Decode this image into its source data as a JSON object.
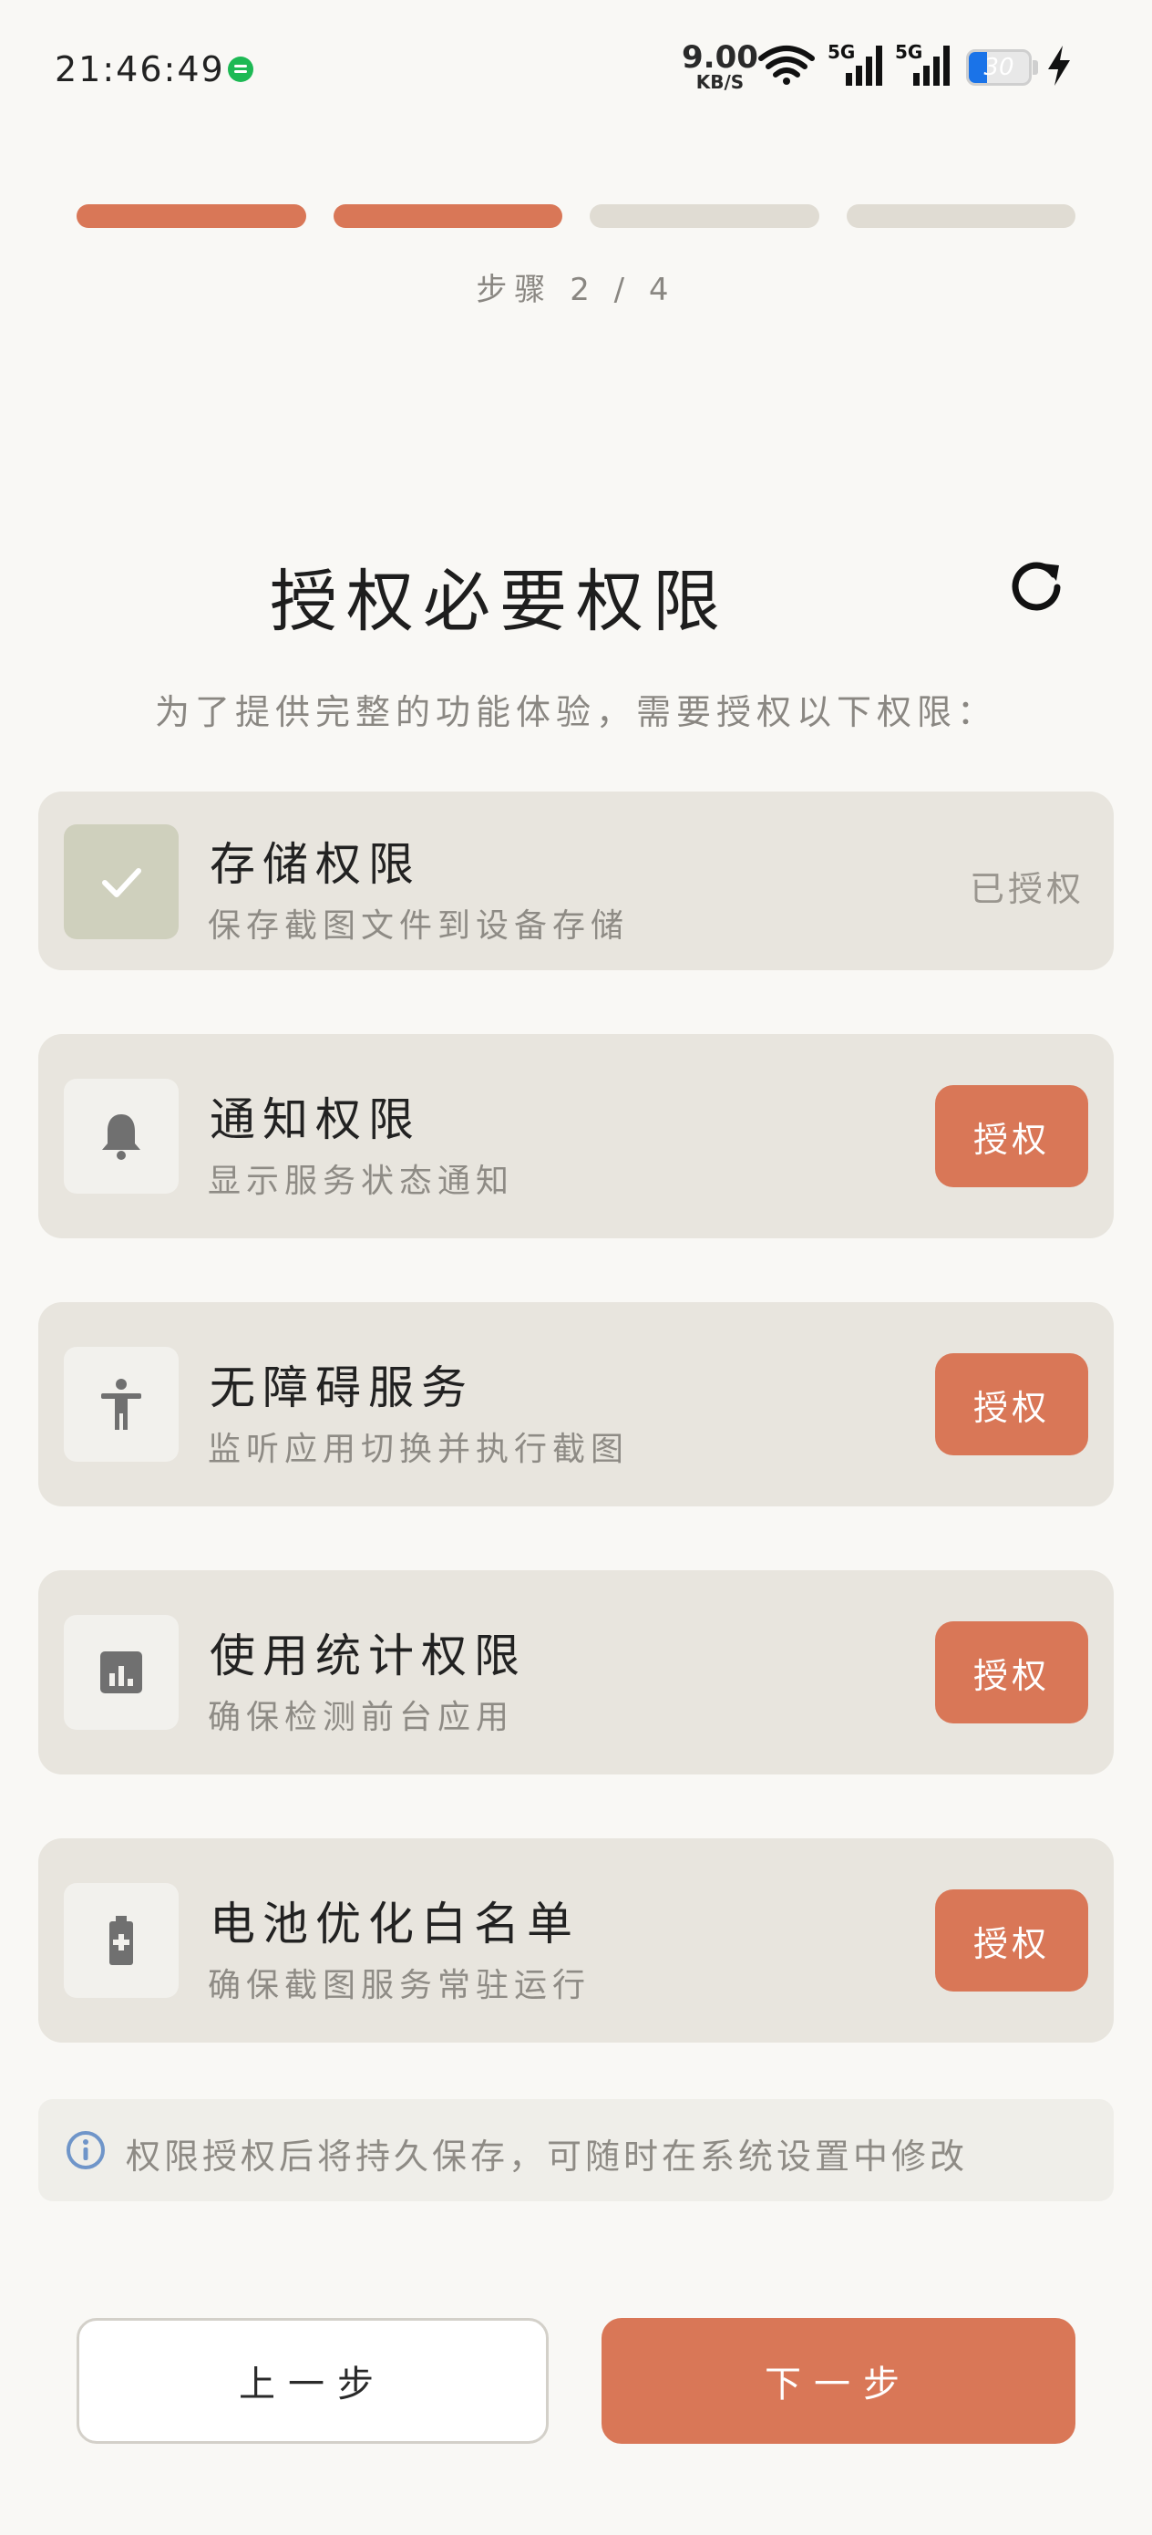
{
  "status_bar": {
    "time": "21:46:49",
    "net_speed_value": "9.00",
    "net_speed_unit": "KB/S",
    "signal1_label": "5G",
    "signal2_label": "5G",
    "battery_level": "30",
    "battery_fraction": 0.3,
    "battery_color": "#1a73e8"
  },
  "progress": {
    "total_steps": 4,
    "current_step": 2,
    "step_text": "步骤 2 / 4",
    "active_color": "#d97757",
    "inactive_color": "#e0dcd3"
  },
  "header": {
    "title": "授权必要权限",
    "refresh_icon": "refresh-icon",
    "subtitle": "为了提供完整的功能体验，需要授权以下权限："
  },
  "permissions": [
    {
      "icon": "check-icon",
      "name": "存储权限",
      "desc": "保存截图文件到设备存储",
      "granted": true,
      "status_text": "已授权"
    },
    {
      "icon": "bell-icon",
      "name": "通知权限",
      "desc": "显示服务状态通知",
      "granted": false,
      "button_label": "授权"
    },
    {
      "icon": "accessibility-icon",
      "name": "无障碍服务",
      "desc": "监听应用切换并执行截图",
      "granted": false,
      "button_label": "授权"
    },
    {
      "icon": "usage-stats-icon",
      "name": "使用统计权限",
      "desc": "确保检测前台应用",
      "granted": false,
      "button_label": "授权"
    },
    {
      "icon": "battery-plus-icon",
      "name": "电池优化白名单",
      "desc": "确保截图服务常驻运行",
      "granted": false,
      "button_label": "授权"
    }
  ],
  "note": {
    "icon": "info-icon",
    "text": "权限授权后将持久保存，可随时在系统设置中修改"
  },
  "footer": {
    "prev_label": "上一步",
    "next_label": "下一步"
  },
  "colors": {
    "accent": "#d97757",
    "background": "#f9f8f5",
    "card": "#e8e5de"
  }
}
